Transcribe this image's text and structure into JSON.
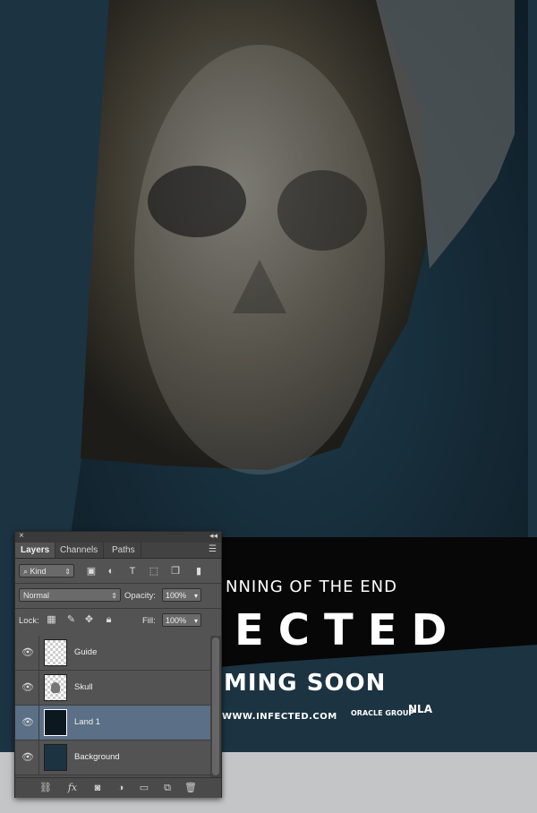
{
  "poster": {
    "tagline": "NNING OF THE END",
    "title": "ECTED",
    "coming": "MING SOON",
    "website": "WWW.INFECTED.COM",
    "logo1": "ORACLE GROUP",
    "logo2": "NLA"
  },
  "panel": {
    "close": "×",
    "collapse": "◂◂",
    "tabs": [
      "Layers",
      "Channels",
      "Paths"
    ],
    "menu_icon": "☰",
    "filter": {
      "kind": "Kind"
    },
    "blend_mode": "Normal",
    "opacity_label": "Opacity:",
    "opacity_value": "100%",
    "lock_label": "Lock:",
    "fill_label": "Fill:",
    "fill_value": "100%",
    "layers": [
      {
        "name": "Guide",
        "thumb": "checker"
      },
      {
        "name": "Skull",
        "thumb": "checker"
      },
      {
        "name": "Land 1",
        "thumb": "land",
        "selected": true
      },
      {
        "name": "Background",
        "thumb": "dark"
      }
    ]
  }
}
